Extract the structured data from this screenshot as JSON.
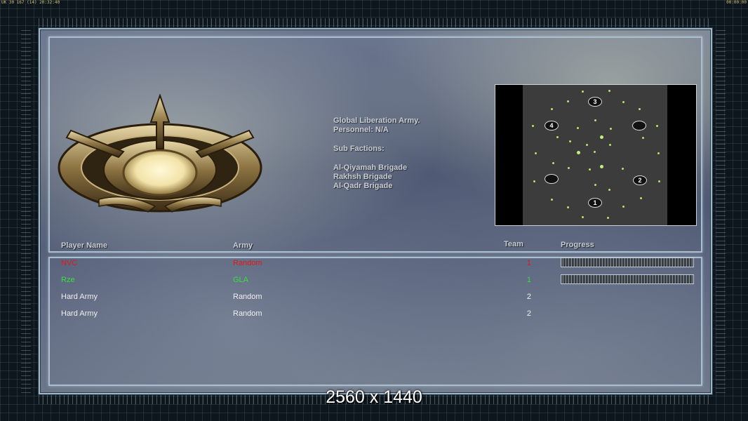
{
  "status_bar": {
    "left": "UK 30 167 (14) 20:32:40",
    "right": "00:00:00"
  },
  "faction": {
    "name": "Global Liberation Army.",
    "personnel": "Personnel: N/A",
    "sub_factions_heading": "Sub Factions:",
    "sub_factions": [
      "Al-Qiyamah Brigade",
      "Rakhsh Brigade",
      "Al-Qadr Brigade"
    ]
  },
  "minimap": {
    "start_positions": [
      "1",
      "2",
      "3",
      "4"
    ]
  },
  "table": {
    "headers": {
      "player_name": "Player Name",
      "army": "Army",
      "team": "Team",
      "progress": "Progress"
    },
    "rows": [
      {
        "name": "NVC",
        "army": "Random",
        "team": "1",
        "color": "#e01818",
        "has_progress": true
      },
      {
        "name": "Rze",
        "army": "GLA",
        "team": "1",
        "color": "#39e03d",
        "has_progress": true
      },
      {
        "name": "Hard Army",
        "army": "Random",
        "team": "2",
        "color": "#f0f0f0",
        "has_progress": false
      },
      {
        "name": "Hard Army",
        "army": "Random",
        "team": "2",
        "color": "#f0f0f0",
        "has_progress": false
      }
    ]
  },
  "overlay_text": "2560 x 1440"
}
